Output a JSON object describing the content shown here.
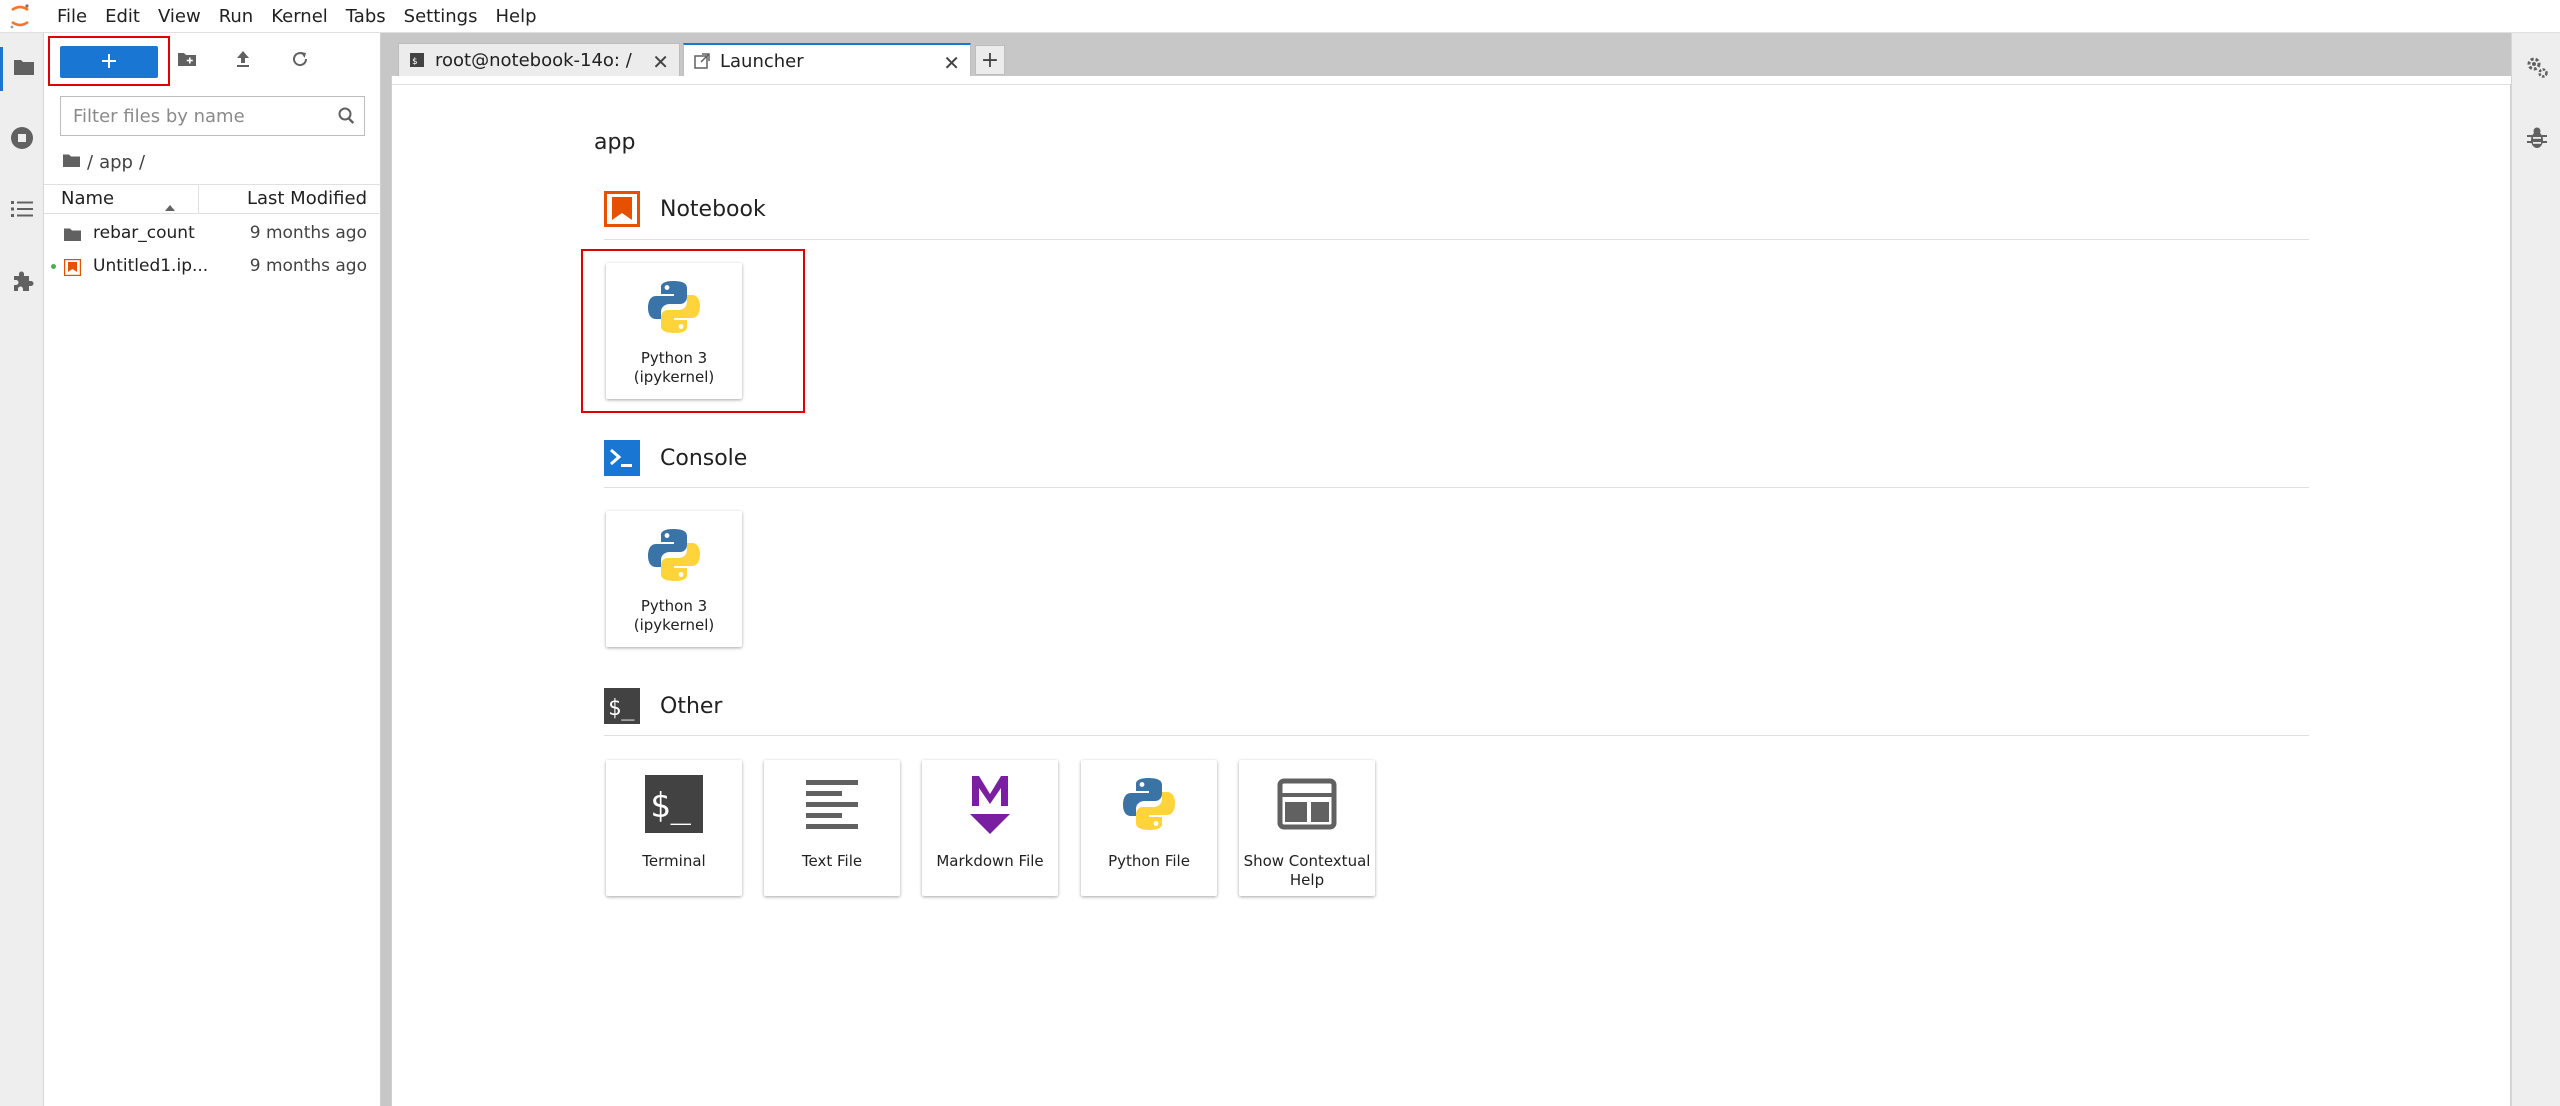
{
  "menu": {
    "items": [
      "File",
      "Edit",
      "View",
      "Run",
      "Kernel",
      "Tabs",
      "Settings",
      "Help"
    ]
  },
  "left_sidebar": {
    "icons": [
      "folder-icon",
      "running-icon",
      "toc-icon",
      "extension-icon"
    ]
  },
  "file_browser": {
    "toolbar": {
      "new_launcher_icon": "plus-icon",
      "new_folder_icon": "new-folder-icon",
      "upload_icon": "upload-icon",
      "refresh_icon": "refresh-icon"
    },
    "search": {
      "placeholder": "Filter files by name",
      "value": ""
    },
    "breadcrumb": {
      "separator": "/",
      "path": "app",
      "trailing": "/"
    },
    "columns": {
      "name": "Name",
      "modified": "Last Modified"
    },
    "files": [
      {
        "name": "rebar_count",
        "type": "folder",
        "modified": "9 months ago",
        "running": false
      },
      {
        "name": "Untitled1.ip...",
        "type": "notebook",
        "modified": "9 months ago",
        "running": true
      }
    ]
  },
  "tabs": [
    {
      "label": "root@notebook-14o: /",
      "icon": "terminal-icon",
      "active": false
    },
    {
      "label": "Launcher",
      "icon": "launcher-icon",
      "active": true
    }
  ],
  "launcher": {
    "cwd": "app",
    "sections": {
      "notebook": {
        "title": "Notebook",
        "cards": [
          {
            "line1": "Python 3",
            "line2": "(ipykernel)"
          }
        ]
      },
      "console": {
        "title": "Console",
        "cards": [
          {
            "line1": "Python 3",
            "line2": "(ipykernel)"
          }
        ]
      },
      "other": {
        "title": "Other",
        "cards": [
          {
            "line1": "Terminal",
            "line2": ""
          },
          {
            "line1": "Text File",
            "line2": ""
          },
          {
            "line1": "Markdown File",
            "line2": ""
          },
          {
            "line1": "Python File",
            "line2": ""
          },
          {
            "line1": "Show Contextual",
            "line2": "Help"
          }
        ]
      }
    }
  },
  "right_sidebar": {
    "icons": [
      "property-inspector-icon",
      "debugger-icon"
    ]
  },
  "colors": {
    "accent": "#1976d2",
    "highlight": "#e00000",
    "notebook_orange": "#e65100",
    "markdown_purple": "#7b1fa2",
    "python_blue": "#3a73a6",
    "python_yellow": "#ffd43b"
  }
}
